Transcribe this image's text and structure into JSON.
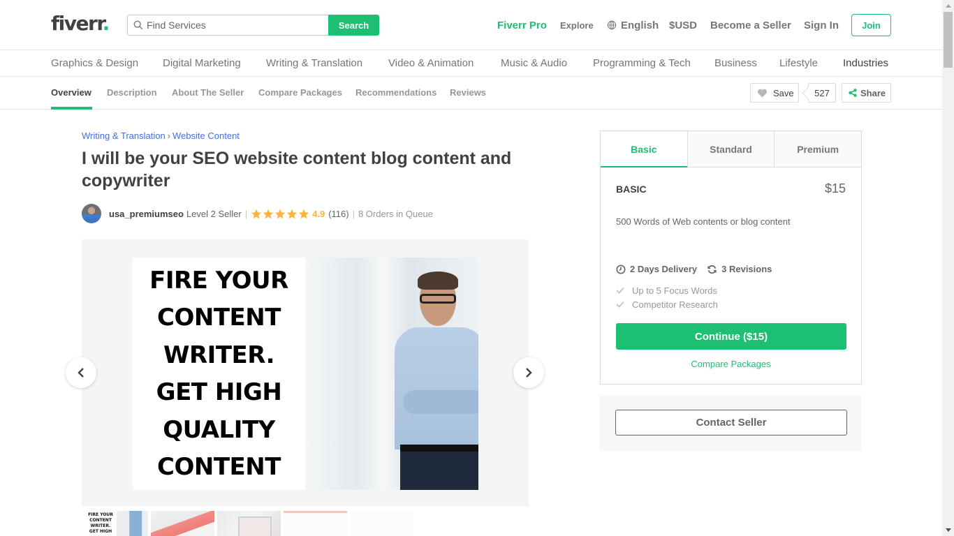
{
  "header": {
    "logo_text": "fiverr",
    "logo_dot": ".",
    "search": {
      "placeholder": "Find Services",
      "value": "",
      "button_label": "Search",
      "icon": "search-icon"
    },
    "nav": {
      "fiverr_pro": "Fiverr Pro",
      "explore": "Explore",
      "language": "English",
      "language_icon": "globe-icon",
      "currency": "$USD",
      "become_seller": "Become a Seller",
      "sign_in": "Sign In",
      "join": "Join"
    }
  },
  "categories": [
    "Graphics & Design",
    "Digital Marketing",
    "Writing & Translation",
    "Video & Animation",
    "Music & Audio",
    "Programming & Tech",
    "Business",
    "Lifestyle",
    "Industries"
  ],
  "subnav": {
    "tabs": [
      "Overview",
      "Description",
      "About The Seller",
      "Compare Packages",
      "Recommendations",
      "Reviews"
    ],
    "active_tab": "Overview",
    "save_label": "Save",
    "save_count": "527",
    "share_label": "Share"
  },
  "gig": {
    "breadcrumb": [
      "Writing & Translation",
      "Website Content"
    ],
    "breadcrumb_separator": "›",
    "title": "I will be your SEO website content blog content and copywriter",
    "seller": {
      "username": "usa_premiumseo",
      "level": "Level 2 Seller",
      "rating": "4.9",
      "stars": 5,
      "reviews_count": "(116)",
      "queue": "8 Orders in Queue"
    },
    "gallery": {
      "slide_text_lines": [
        "FIRE YOUR",
        "CONTENT",
        "WRITER.",
        "GET HIGH",
        "QUALITY",
        "CONTENT"
      ],
      "thumbnail_count": 5,
      "thumb1_text": [
        "FIRE YOUR",
        "CONTENT",
        "WRITER.",
        "GET HIGH"
      ],
      "active_index": 1
    }
  },
  "package": {
    "tabs": [
      "Basic",
      "Standard",
      "Premium"
    ],
    "active_tab": "Basic",
    "name": "BASIC",
    "price": "$15",
    "description": "500 Words of Web contents or blog content",
    "delivery": "2 Days Delivery",
    "revisions": "3 Revisions",
    "features": [
      "Up to 5 Focus Words",
      "Competitor Research"
    ],
    "continue_label": "Continue ($15)",
    "compare_label": "Compare Packages",
    "contact_label": "Contact Seller"
  },
  "colors": {
    "brand_green": "#1dbf73",
    "link_blue": "#446ee7",
    "star_yellow": "#ffb33e",
    "text_dark": "#404145"
  }
}
